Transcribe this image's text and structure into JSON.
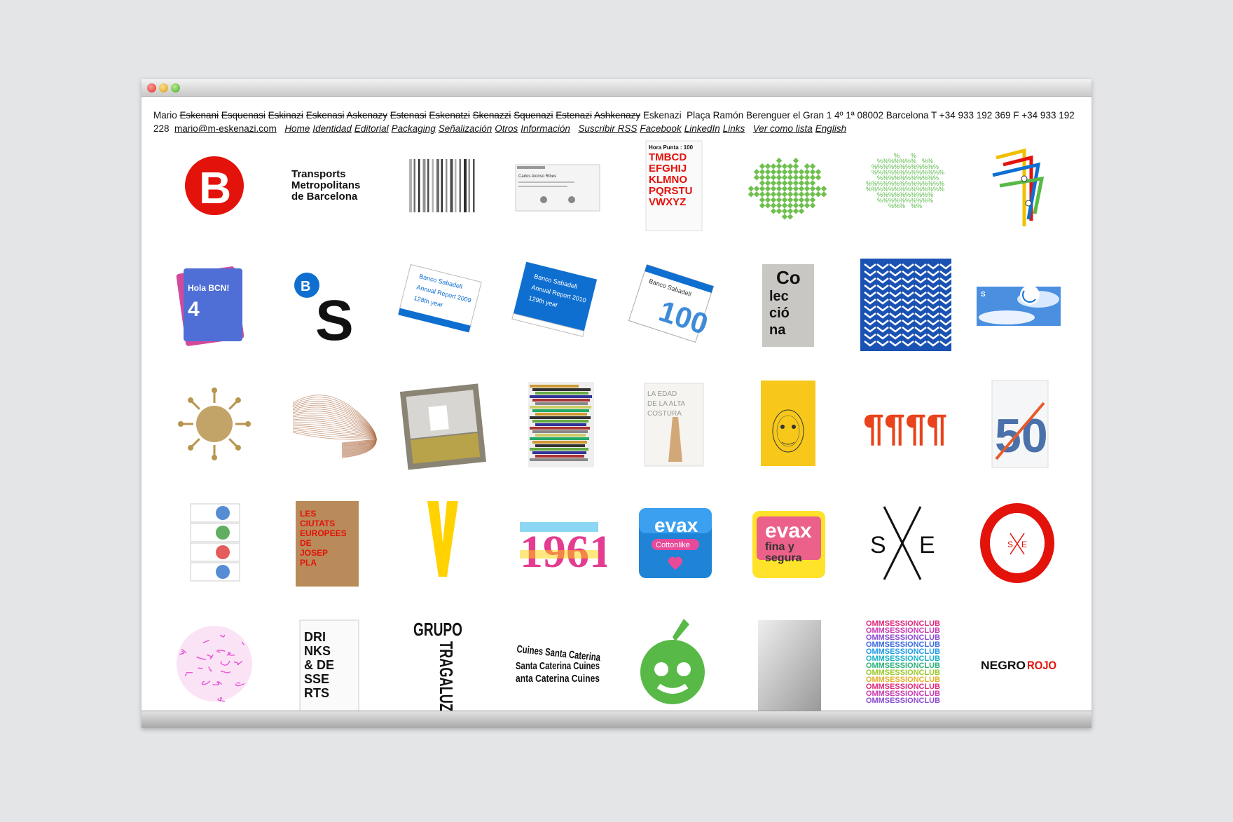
{
  "header": {
    "first_name": "Mario",
    "struck_names": [
      "Eskenani",
      "Esquenasi",
      "Eskinazi",
      "Eskenasi",
      "Askenazy",
      "Estenasi",
      "Eskenatzi",
      "Skenazzi",
      "Squenazi",
      "Estenazi",
      "Ashkenazy"
    ],
    "last_name": "Eskenazi",
    "address": "Plaça Ramón Berenguer el Gran 1 4º 1ª  08002 Barcelona  T +34 933 192 369  F +34 933 192 228",
    "email": "mario@m-eskenazi.com",
    "nav": [
      "Home",
      "Identidad",
      "Editorial",
      "Packaging",
      "Señalización",
      "Otros",
      "Información"
    ],
    "links": [
      "Suscribir RSS",
      "Facebook",
      "LinkedIn",
      "Links",
      "Ver como lista",
      "English"
    ]
  },
  "thumbs": [
    {
      "name": "b-logo-red",
      "texts": [
        "B"
      ]
    },
    {
      "name": "tmb-wordmark",
      "texts": [
        "Transports",
        "Metropolitans",
        "de Barcelona"
      ]
    },
    {
      "name": "barcode-pattern",
      "texts": []
    },
    {
      "name": "business-card",
      "texts": [
        "Carlos Alonso Ribes"
      ]
    },
    {
      "name": "hora-punta-poster",
      "texts": [
        "Hora Punta : 100",
        "TMBCD",
        "EFGHIJ",
        "KLMNO",
        "PQRSTU",
        "VWXYZ"
      ]
    },
    {
      "name": "green-map-dragon",
      "texts": []
    },
    {
      "name": "green-percent-map",
      "texts": []
    },
    {
      "name": "metro-number-one",
      "texts": []
    },
    {
      "name": "hola-bcn-cards",
      "texts": [
        "Hola BCN!",
        "4"
      ]
    },
    {
      "name": "bs-logo",
      "texts": [
        "B",
        "S"
      ]
    },
    {
      "name": "annual-report-2009",
      "texts": [
        "Banco Sabadell",
        "Annual Report 2009",
        "128th year"
      ]
    },
    {
      "name": "annual-report-2010",
      "texts": [
        "Banco Sabadell",
        "Annual Report 2010",
        "129th year"
      ]
    },
    {
      "name": "sabadell-100-book",
      "texts": [
        "Banco Sabadell",
        "100"
      ]
    },
    {
      "name": "coleccion-book",
      "texts": [
        "Co",
        "lec",
        "ció",
        "na"
      ]
    },
    {
      "name": "blue-chevron-pattern",
      "texts": []
    },
    {
      "name": "sky-card",
      "texts": [
        "S"
      ]
    },
    {
      "name": "gold-star-emblem",
      "texts": []
    },
    {
      "name": "copper-wave-sculpture",
      "texts": []
    },
    {
      "name": "interior-photo-book",
      "texts": []
    },
    {
      "name": "striped-photo-book",
      "texts": []
    },
    {
      "name": "la-edad-book",
      "texts": [
        "LA EDAD",
        "DE LA ALTA",
        "COSTURA"
      ]
    },
    {
      "name": "yellow-portrait-book",
      "texts": []
    },
    {
      "name": "pilcrow-logo",
      "texts": [
        "¶¶¶¶"
      ]
    },
    {
      "name": "fifty-poster",
      "texts": [
        "50"
      ]
    },
    {
      "name": "portrait-strip-cards",
      "texts": []
    },
    {
      "name": "ciutats-europees-book",
      "texts": [
        "LES",
        "CIUTATS",
        "EUROPEES",
        "DE",
        "JOSEP",
        "PLA"
      ]
    },
    {
      "name": "yellow-v-logo",
      "texts": []
    },
    {
      "name": "colorful-1961-type",
      "texts": [
        "1961"
      ]
    },
    {
      "name": "evax-cottonlike-pack",
      "texts": [
        "evax",
        "Cottonlike"
      ]
    },
    {
      "name": "evax-fina-pack",
      "texts": [
        "evax",
        "fina y",
        "segura"
      ]
    },
    {
      "name": "sxe-logo",
      "texts": [
        "S",
        "E"
      ]
    },
    {
      "name": "red-o-sxe-logo",
      "texts": [
        "S",
        "E"
      ]
    },
    {
      "name": "magenta-circle-pattern",
      "texts": []
    },
    {
      "name": "drinks-desserts-menu",
      "texts": [
        "DRI",
        "NKS",
        "& DE",
        "SSE",
        "RTS"
      ]
    },
    {
      "name": "grupo-tragaluz",
      "texts": [
        "GRUPO",
        "TRAGALUZ"
      ]
    },
    {
      "name": "cuines-santa-caterina",
      "texts": [
        "Cuines Santa Caterina",
        "Santa Caterina Cuines",
        "anta Caterina Cuines"
      ]
    },
    {
      "name": "green-apple-logo",
      "texts": []
    },
    {
      "name": "silver-book",
      "texts": []
    },
    {
      "name": "omm-session-club",
      "texts": [
        "OMMSESSIONCLUB"
      ]
    },
    {
      "name": "negro-rojo-logo",
      "texts": [
        "NEGRO",
        "ROJO"
      ]
    }
  ],
  "colors": {
    "red": "#e3120b",
    "blue": "#0f6fd0",
    "green": "#58b947",
    "gold": "#b8944e",
    "yellow": "#ffd200"
  }
}
